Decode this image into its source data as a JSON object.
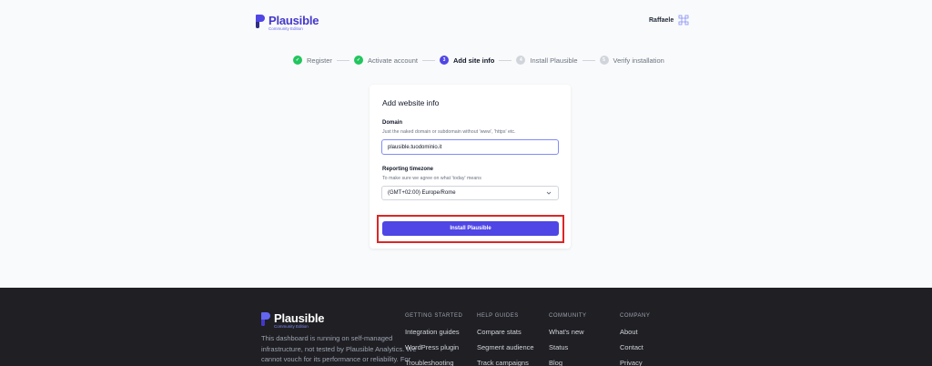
{
  "brand": {
    "name": "Plausible",
    "edition": "Community Edition",
    "color": "#4f46e5"
  },
  "user": {
    "name": "Raffaele"
  },
  "steps": [
    {
      "number": "1",
      "label": "Register",
      "state": "done"
    },
    {
      "number": "2",
      "label": "Activate account",
      "state": "done"
    },
    {
      "number": "3",
      "label": "Add site info",
      "state": "active"
    },
    {
      "number": "4",
      "label": "Install Plausible",
      "state": "todo"
    },
    {
      "number": "5",
      "label": "Verify installation",
      "state": "todo"
    }
  ],
  "form": {
    "title": "Add website info",
    "domain": {
      "label": "Domain",
      "hint": "Just the naked domain or subdomain without 'www', 'https' etc.",
      "value": "plausible.tuodominio.it"
    },
    "timezone": {
      "label": "Reporting timezone",
      "hint": "To make sure we agree on what 'today' means",
      "value": "(GMT+02:00) Europe/Rome"
    },
    "submit_label": "Install Plausible",
    "highlight_color": "#dc2626"
  },
  "footer": {
    "description": "This dashboard is running on self-managed infrastructure, not tested by Plausible Analytics. We cannot vouch for its performance or reliability. For official managed",
    "columns": [
      {
        "heading": "GETTING STARTED",
        "links": [
          "Integration guides",
          "WordPress plugin",
          "Troubleshooting"
        ]
      },
      {
        "heading": "HELP GUIDES",
        "links": [
          "Compare stats",
          "Segment audience",
          "Track campaigns"
        ]
      },
      {
        "heading": "COMMUNITY",
        "links": [
          "What's new",
          "Status",
          "Blog"
        ]
      },
      {
        "heading": "COMPANY",
        "links": [
          "About",
          "Contact",
          "Privacy"
        ]
      }
    ]
  }
}
